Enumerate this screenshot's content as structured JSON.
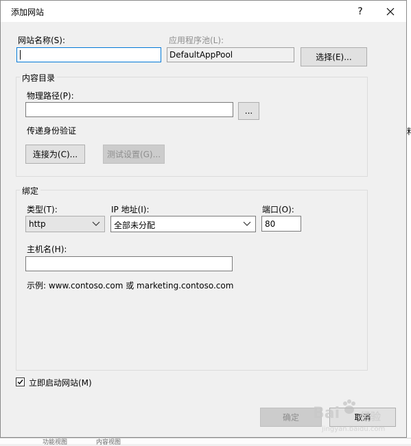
{
  "dialog": {
    "title": "添加网站",
    "help_button": "?",
    "close_button": "✕"
  },
  "site": {
    "name_label": "网站名称(S):",
    "name_value": "",
    "app_pool_label": "应用程序池(L):",
    "app_pool_value": "DefaultAppPool",
    "select_button": "选择(E)..."
  },
  "content": {
    "group_label": "内容目录",
    "physical_path_label": "物理路径(P):",
    "physical_path_value": "",
    "browse_button": "...",
    "pass_through_label": "传递身份验证",
    "connect_as_button": "连接为(C)...",
    "test_settings_button": "测试设置(G)..."
  },
  "binding": {
    "group_label": "绑定",
    "type_label": "类型(T):",
    "type_value": "http",
    "ip_label": "IP 地址(I):",
    "ip_value": "全部未分配",
    "port_label": "端口(O):",
    "port_value": "80",
    "hostname_label": "主机名(H):",
    "hostname_value": "",
    "example_text": "示例: www.contoso.com 或 marketing.contoso.com"
  },
  "start_now": {
    "label": "立即启动网站(M)",
    "checked": true
  },
  "footer": {
    "ok_button": "确定",
    "cancel_button": "取消"
  },
  "background": {
    "right_edge_char": "料",
    "tab_feature_view": "功能视图",
    "tab_content_view": "内容视图"
  },
  "watermark": {
    "text": "Bai",
    "suffix": "经验",
    "url": "jingyan.baidu.com"
  }
}
